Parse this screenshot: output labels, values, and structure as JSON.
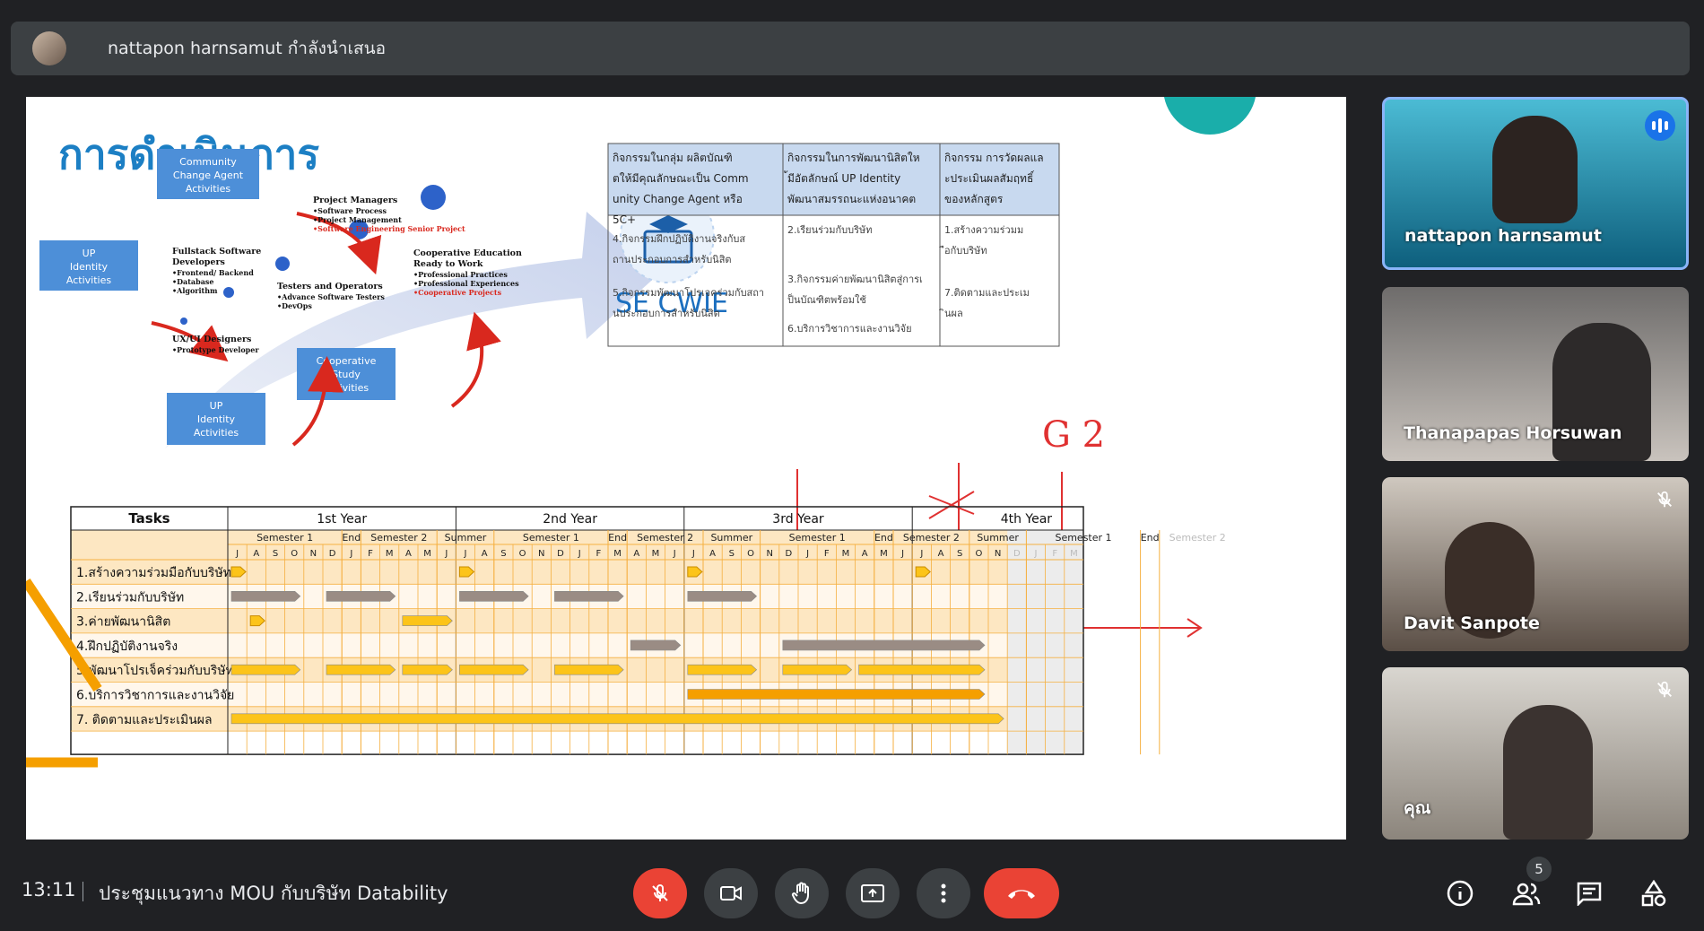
{
  "header": {
    "presenter": "nattapon harnsamut กำลังนำเสนอ"
  },
  "slide": {
    "title": "การดำเนินการ",
    "boxes": [
      "Community Change Agent Activities",
      "UP Identity Activities",
      "UP Identity Activities",
      "Cooperative Study Activities"
    ],
    "arrow_labels": [
      {
        "title": "UX/UI Designers",
        "items": [
          "•Prototype Developer"
        ]
      },
      {
        "title": "Fullstack Software Developers",
        "items": [
          "•Frontend/ Backend",
          "•Database",
          "•Algorithm"
        ]
      },
      {
        "title": "Testers and Operators",
        "items": [
          "•Advance Software Testers",
          "•DevOps"
        ]
      },
      {
        "title": "Project Managers",
        "items": [
          "•Software Process",
          "•Project Management"
        ],
        "red": [
          "•Software Engineering Senior Project"
        ]
      },
      {
        "title": "Cooperative Education Ready to Work",
        "items": [
          "•Professional Practices",
          "•Professional Experiences"
        ],
        "red": [
          "•Cooperative Projects"
        ]
      }
    ],
    "logo_text": "SE CWIE",
    "activity_table": {
      "headers": [
        "กิจกรรมในกลุ่ม ผลิตบัณฑิตให้มีคุณลักษณะเป็น Community Change Agent หรือ 5C+",
        "กิจกรรมในการพัฒนานิสิตให้มีอัตลักษณ์ UP Identity พัฒนาสมรรถนะแห่งอนาคต",
        "กิจกรรม การวัดผลและประเมินผลสัมฤทธิ์ของหลักสูตร"
      ],
      "cells": [
        [
          "4.กิจกรรมฝึกปฏิบัติงานจริงกับสถานประกอบการสำหรับนิสิต",
          "5.กิจกรรมพัฒนาโปรเจคร่วมกับสถานประกอบการสำหรับนิสิต"
        ],
        [
          "2.เรียนร่วมกับบริษัท",
          "3.กิจกรรมค่ายพัฒนานิสิตสู่การเป็นบัณฑิตพร้อมใช้",
          "6.บริการวิชาการและงานวิจัย"
        ],
        [
          "1.สร้างความร่วมมือกับบริษัท",
          "7.ติดตามและประเมินผล"
        ]
      ]
    },
    "handwriting": "G 2",
    "gantt": {
      "tasks_header": "Tasks",
      "years": [
        "1st Year",
        "2nd Year",
        "3rd Year",
        "4th Year"
      ],
      "semesters": [
        {
          "label": "Semester 1",
          "months": 6
        },
        {
          "label": "End",
          "months": 1
        },
        {
          "label": "Semester 2",
          "months": 4
        },
        {
          "label": "Summer",
          "months": 3
        },
        {
          "label": "Semester 1",
          "months": 6
        },
        {
          "label": "End",
          "months": 1
        },
        {
          "label": "Semester 2",
          "months": 4
        },
        {
          "label": "Summer",
          "months": 3
        },
        {
          "label": "Semester 1",
          "months": 6
        },
        {
          "label": "End",
          "months": 1
        },
        {
          "label": "Semester 2",
          "months": 4
        },
        {
          "label": "Summer",
          "months": 3
        },
        {
          "label": "Semester 1",
          "months": 6
        },
        {
          "label": "End",
          "months": 1
        },
        {
          "label": "Semester 2",
          "months": 4
        }
      ],
      "months": [
        "J",
        "A",
        "S",
        "O",
        "N",
        "D",
        "J",
        "F",
        "M",
        "A",
        "M",
        "J",
        "J",
        "A",
        "S",
        "O",
        "N",
        "D",
        "J",
        "F",
        "M",
        "A",
        "M",
        "J",
        "J",
        "A",
        "S",
        "O",
        "N",
        "D",
        "J",
        "F",
        "M",
        "A",
        "M",
        "J",
        "J",
        "A",
        "S",
        "O",
        "N",
        "D",
        "J",
        "F",
        "M"
      ],
      "tasks": [
        "1.สร้างความร่วมมือกับบริษัท",
        "2.เรียนร่วมกับบริษัท",
        "3.ค่ายพัฒนานิสิต",
        "4.ฝึกปฏิบัติงานจริง",
        "5.พัฒนาโปรเจ็คร่วมกับบริษัท",
        "6.บริการวิชาการและงานวิจัย",
        "7. ติดตามและประเมินผล"
      ],
      "bars": [
        {
          "row": 0,
          "start": 0,
          "end": 1,
          "color": "#fcc419",
          "marker": true
        },
        {
          "row": 0,
          "start": 12,
          "end": 13,
          "color": "#fcc419",
          "marker": true
        },
        {
          "row": 0,
          "start": 24,
          "end": 25,
          "color": "#fcc419",
          "marker": true
        },
        {
          "row": 0,
          "start": 36,
          "end": 37,
          "color": "#fcc419",
          "marker": true
        },
        {
          "row": 1,
          "start": 0,
          "end": 4,
          "color": "#9a8c84"
        },
        {
          "row": 1,
          "start": 5,
          "end": 9,
          "color": "#9a8c84"
        },
        {
          "row": 1,
          "start": 12,
          "end": 16,
          "color": "#9a8c84"
        },
        {
          "row": 1,
          "start": 17,
          "end": 21,
          "color": "#9a8c84"
        },
        {
          "row": 1,
          "start": 24,
          "end": 28,
          "color": "#9a8c84"
        },
        {
          "row": 2,
          "start": 1,
          "end": 2,
          "color": "#fcc419",
          "marker": true
        },
        {
          "row": 2,
          "start": 9,
          "end": 12,
          "color": "#fcc419"
        },
        {
          "row": 3,
          "start": 21,
          "end": 24,
          "color": "#9a8c84"
        },
        {
          "row": 3,
          "start": 29,
          "end": 40,
          "color": "#9a8c84"
        },
        {
          "row": 4,
          "start": 0,
          "end": 4,
          "color": "#fcc419"
        },
        {
          "row": 4,
          "start": 5,
          "end": 9,
          "color": "#fcc419"
        },
        {
          "row": 4,
          "start": 9,
          "end": 12,
          "color": "#fcc419"
        },
        {
          "row": 4,
          "start": 12,
          "end": 16,
          "color": "#fcc419"
        },
        {
          "row": 4,
          "start": 17,
          "end": 21,
          "color": "#fcc419"
        },
        {
          "row": 4,
          "start": 24,
          "end": 28,
          "color": "#fcc419"
        },
        {
          "row": 4,
          "start": 29,
          "end": 33,
          "color": "#fcc419"
        },
        {
          "row": 4,
          "start": 33,
          "end": 40,
          "color": "#fcc419"
        },
        {
          "row": 5,
          "start": 24,
          "end": 40,
          "color": "#f59f00"
        },
        {
          "row": 6,
          "start": 0,
          "end": 41,
          "color": "#fcc419"
        }
      ]
    }
  },
  "participants": [
    {
      "name": "nattapon harnsamut",
      "speaking": true
    },
    {
      "name": "Thanapapas Horsuwan",
      "muted": false
    },
    {
      "name": "Davit Sanpote",
      "muted": true
    },
    {
      "name": "คุณ",
      "muted": true
    }
  ],
  "bottom": {
    "time": "13:11",
    "meeting_title": "ประชุมแนวทาง MOU กับบริษัท Datability",
    "participant_count": "5"
  },
  "colors": {
    "background": "#202124",
    "button": "#3c4043",
    "end_call": "#ea4335",
    "slide_title": "#1c7fc4",
    "box": "#4d8fd8",
    "gantt_header": "#fde7c2",
    "gantt_line": "#f5b041"
  }
}
